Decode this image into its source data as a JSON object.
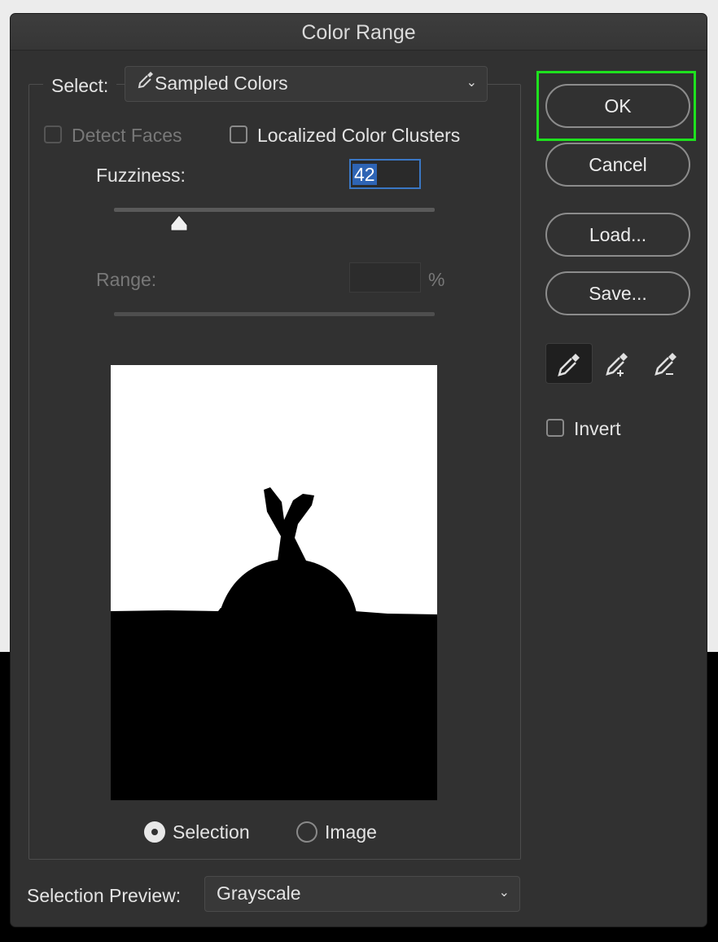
{
  "window": {
    "title": "Color Range"
  },
  "select": {
    "label": "Select:",
    "value": "Sampled Colors",
    "icon": "eyedropper-icon"
  },
  "options": {
    "detect_faces": {
      "label": "Detect Faces",
      "checked": false,
      "enabled": false
    },
    "localized_clusters": {
      "label": "Localized Color Clusters",
      "checked": false
    }
  },
  "fuzziness": {
    "label": "Fuzziness:",
    "value": "42"
  },
  "range": {
    "label": "Range:",
    "value": "",
    "unit": "%"
  },
  "preview_mode": {
    "selected": "Selection",
    "options": [
      {
        "label": "Selection",
        "checked": true
      },
      {
        "label": "Image",
        "checked": false
      }
    ]
  },
  "selection_preview": {
    "label": "Selection Preview:",
    "value": "Grayscale"
  },
  "buttons": {
    "ok": "OK",
    "cancel": "Cancel",
    "load": "Load...",
    "save": "Save..."
  },
  "tools": [
    {
      "name": "eyedropper-icon",
      "active": true
    },
    {
      "name": "eyedropper-plus-icon",
      "active": false
    },
    {
      "name": "eyedropper-minus-icon",
      "active": false
    }
  ],
  "invert": {
    "label": "Invert",
    "checked": false
  },
  "colors": {
    "highlight": "#1ee11e",
    "focus": "#3a77c4",
    "dialog_bg": "#313131"
  }
}
